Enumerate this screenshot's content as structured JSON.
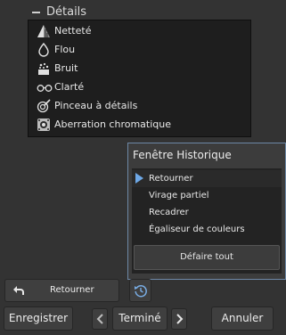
{
  "section": {
    "title": "Détails"
  },
  "details": {
    "items": [
      {
        "label": "Netteté",
        "icon": "sharpen-icon"
      },
      {
        "label": "Flou",
        "icon": "blur-drop-icon"
      },
      {
        "label": "Bruit",
        "icon": "noise-icon"
      },
      {
        "label": "Clarté",
        "icon": "clarity-glasses-icon"
      },
      {
        "label": "Pinceau à détails",
        "icon": "detail-brush-icon"
      },
      {
        "label": "Aberration chromatique",
        "icon": "chromatic-aberration-icon"
      }
    ]
  },
  "history": {
    "title": "Fenêtre Historique",
    "items": [
      {
        "label": "Retourner",
        "active": true
      },
      {
        "label": "Virage partiel"
      },
      {
        "label": "Recadrer"
      },
      {
        "label": "Égaliseur de couleurs"
      }
    ],
    "undo_all_label": "Défaire tout"
  },
  "bottom": {
    "back_label": "Retourner",
    "save_label": "Enregistrer",
    "done_label": "Terminé",
    "cancel_label": "Annuler"
  },
  "colors": {
    "background": "#333333",
    "panel": "#1e1e1e",
    "accent": "#6ea8e6",
    "window_border": "#6d88a6"
  }
}
